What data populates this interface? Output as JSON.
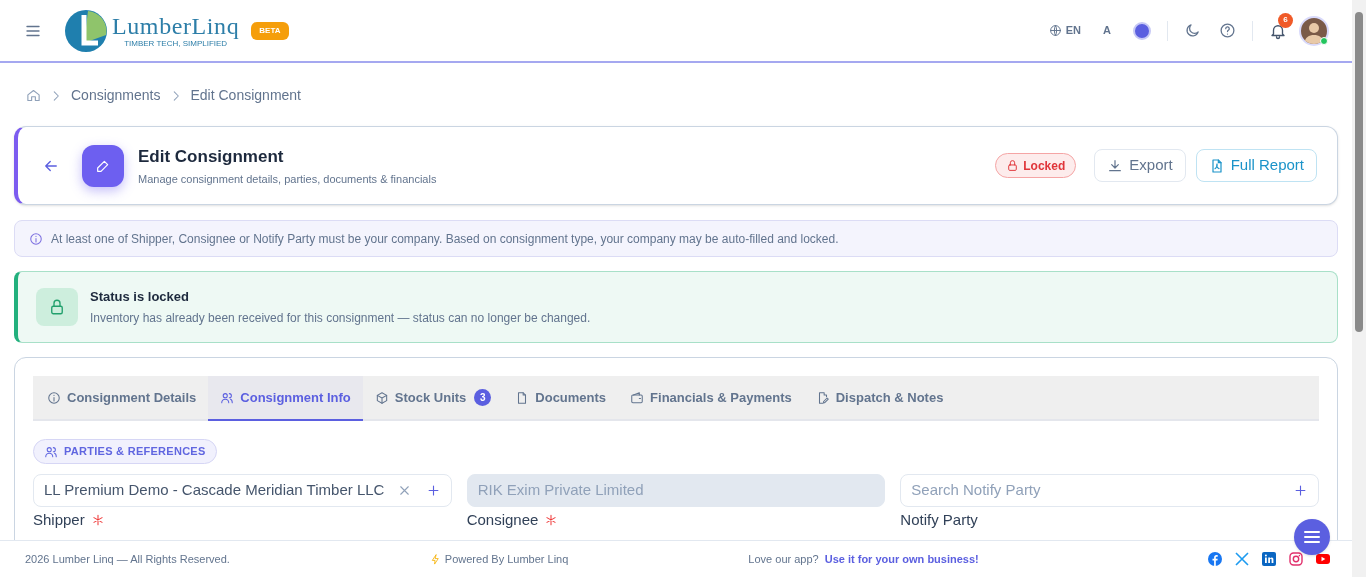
{
  "header": {
    "logo": {
      "name": "LumberLinq",
      "tagline": "TIMBER TECH, SIMPLIFIED"
    },
    "badge": "BETA",
    "language": "EN",
    "font_toggle": "A",
    "notifications": "6",
    "user_online": true
  },
  "breadcrumb": [
    "Consignments",
    "Edit Consignment"
  ],
  "page_header": {
    "title": "Edit Consignment",
    "subtitle": "Manage consignment details, parties, documents & financials",
    "status_badge": "Locked",
    "buttons": [
      {
        "kind": "export",
        "label": "Export"
      },
      {
        "kind": "report",
        "label": "Full Report"
      }
    ]
  },
  "info_notice": "At least one of Shipper, Consignee or Notify Party must be your company. Based on consignment type, your company may be auto-filled and locked.",
  "lock_notice": {
    "title": "Status is locked",
    "message": "Inventory has already been received for this consignment — status can no longer be changed."
  },
  "tabs": [
    {
      "kind": "info",
      "label": "Consignment Details",
      "selected": false
    },
    {
      "kind": "users",
      "label": "Consignment Info",
      "selected": true
    },
    {
      "kind": "box",
      "label": "Stock Units",
      "selected": false,
      "count": "3"
    },
    {
      "kind": "file",
      "label": "Documents",
      "selected": false
    },
    {
      "kind": "wallet",
      "label": "Financials & Payments",
      "selected": false
    },
    {
      "kind": "note",
      "label": "Dispatch & Notes",
      "selected": false
    }
  ],
  "section_label": "PARTIES & REFERENCES",
  "fields": [
    {
      "label": "Shipper",
      "required": true,
      "value": "LL Premium Demo - Cascade Meridian Timber LLC",
      "disabled": false,
      "clearable": true,
      "addable": true
    },
    {
      "label": "Consignee",
      "required": true,
      "value": "RIK Exim Private Limited",
      "disabled": true,
      "clearable": false,
      "addable": false
    },
    {
      "label": "Notify Party",
      "required": false,
      "placeholder": "Search Notify Party",
      "disabled": false,
      "clearable": false,
      "addable": true
    }
  ],
  "footer": {
    "copyright": "2026 Lumber Linq — All Rights Reserved.",
    "powered": "Powered By Lumber Linq",
    "promo": "Love our app?",
    "promo_link": "Use it for your own business!"
  }
}
